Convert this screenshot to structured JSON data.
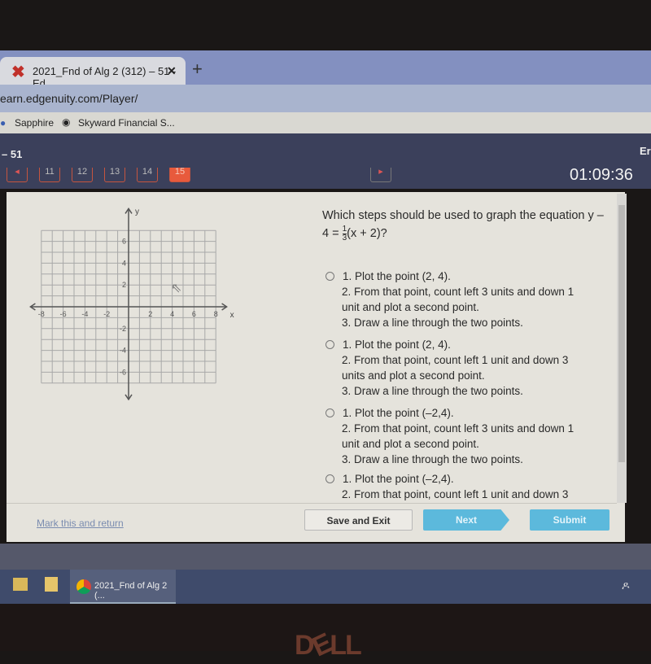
{
  "browser": {
    "tab_title": "2021_Fnd of Alg 2 (312) – 51 - Ed",
    "url": "earn.edgenuity.com/Player/",
    "bookmarks": [
      "Sapphire",
      "Skyward Financial S..."
    ]
  },
  "header": {
    "title_suffix": "– 51",
    "right_text": "Er",
    "question_numbers": [
      "11",
      "12",
      "13",
      "14",
      "15"
    ],
    "current_question": "15",
    "timer": "01:09:36"
  },
  "question": {
    "text_line1": "Which steps should be used to graph the equation y –",
    "eq_prefix": "4 =",
    "frac_num": "1",
    "frac_den": "3",
    "eq_suffix": "(x + 2)?",
    "options": [
      [
        "1. Plot the point (2, 4).",
        "2. From that point, count left 3 units and down 1",
        "unit and plot a second point.",
        "3. Draw a line through the two points."
      ],
      [
        "1. Plot the point (2, 4).",
        "2. From that point, count left 1 unit and down 3",
        "units and plot a second point.",
        "3. Draw a line through the two points."
      ],
      [
        "1. Plot the point (–2,4).",
        "2. From that point, count left 3 units and down 1",
        "unit and plot a second point.",
        "3. Draw a line through the two points."
      ],
      [
        "1. Plot the point (–2,4).",
        "2. From that point, count left 1 unit and down 3"
      ]
    ]
  },
  "graph": {
    "x_label": "x",
    "y_label": "y",
    "x_ticks": [
      "-8",
      "-6",
      "-4",
      "-2",
      "2",
      "4",
      "6",
      "8"
    ],
    "y_ticks": [
      "6",
      "4",
      "2",
      "-2",
      "-4",
      "-6"
    ]
  },
  "footer": {
    "mark_link": "Mark this and return",
    "save_exit": "Save and Exit",
    "next": "Next",
    "submit": "Submit"
  },
  "taskbar": {
    "chrome_item": "2021_Fnd of Alg 2 (..."
  },
  "bezel_logo": "DELL",
  "colors": {
    "accent": "#e85a3c",
    "button_blue": "#5cb9dc",
    "header": "#3b405b"
  }
}
